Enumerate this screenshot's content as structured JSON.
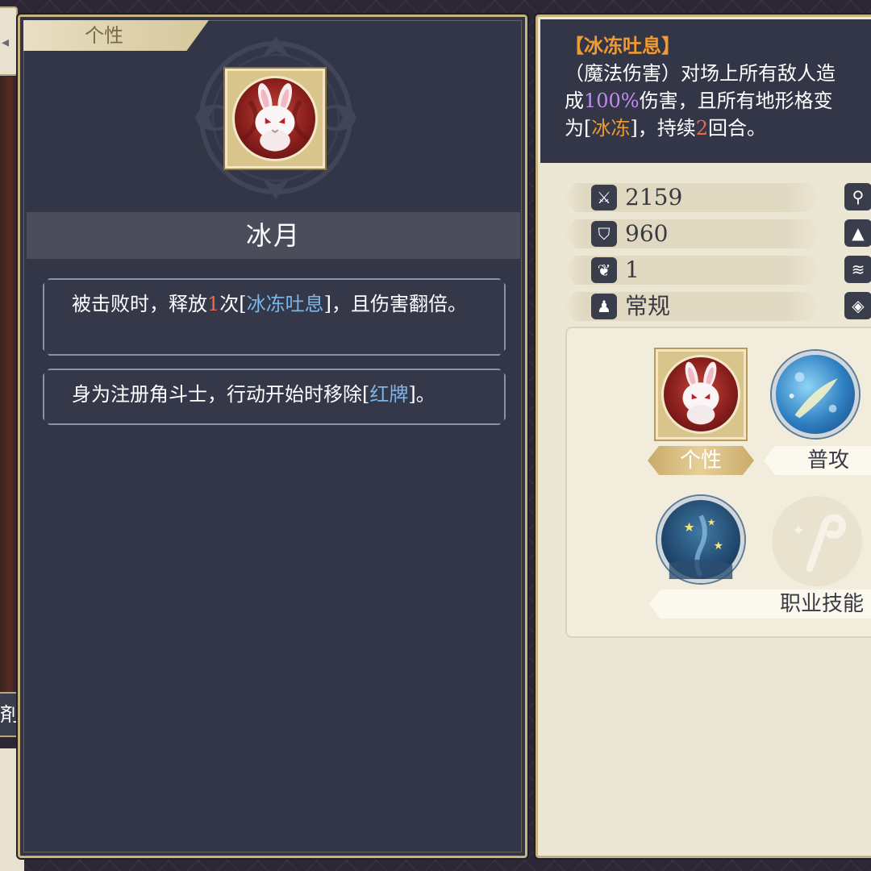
{
  "left_panel": {
    "tab_label": "个性",
    "character_name": "冰月",
    "traits": [
      {
        "parts": [
          {
            "text": "被击败时，释放",
            "cls": ""
          },
          {
            "text": "1",
            "cls": "hl-red"
          },
          {
            "text": "次[",
            "cls": ""
          },
          {
            "text": "冰冻吐息",
            "cls": "hl-blue"
          },
          {
            "text": "]，且伤害翻倍。",
            "cls": ""
          }
        ]
      },
      {
        "parts": [
          {
            "text": "身为注册角斗士，行动开始时移除[",
            "cls": ""
          },
          {
            "text": "红牌",
            "cls": "hl-blue"
          },
          {
            "text": "]。",
            "cls": ""
          }
        ]
      }
    ],
    "edge_label": "剤"
  },
  "skill_desc": {
    "title": "【冰冻吐息】",
    "line1": "（魔法伤害）对场上所有敌人造",
    "line2_pre": "成",
    "line2_pct": "100%",
    "line2_post": "伤害，且所有地形格变",
    "line3_pre": "为[",
    "line3_kw": "冰冻",
    "line3_mid": "]，持续",
    "line3_num": "2",
    "line3_post": "回合。"
  },
  "stats": [
    {
      "icon": "sword-icon",
      "glyph": "⚔",
      "value": "2159"
    },
    {
      "icon": "shield-icon",
      "glyph": "⛉",
      "value": "960"
    },
    {
      "icon": "wing-icon",
      "glyph": "❦",
      "value": "1"
    },
    {
      "icon": "figure-icon",
      "glyph": "♟",
      "value": "常规"
    }
  ],
  "skills": {
    "trait_label": "个性",
    "normal_attack_label": "普攻",
    "class_skill_label": "职业技能"
  },
  "colors": {
    "panel_dark": "#323646",
    "panel_light": "#ece6d4",
    "gold": "#c8b27e",
    "highlight_red": "#e96b4d",
    "highlight_blue": "#7bb6ea",
    "highlight_orange": "#f09a33",
    "highlight_purple": "#c28bf2"
  }
}
